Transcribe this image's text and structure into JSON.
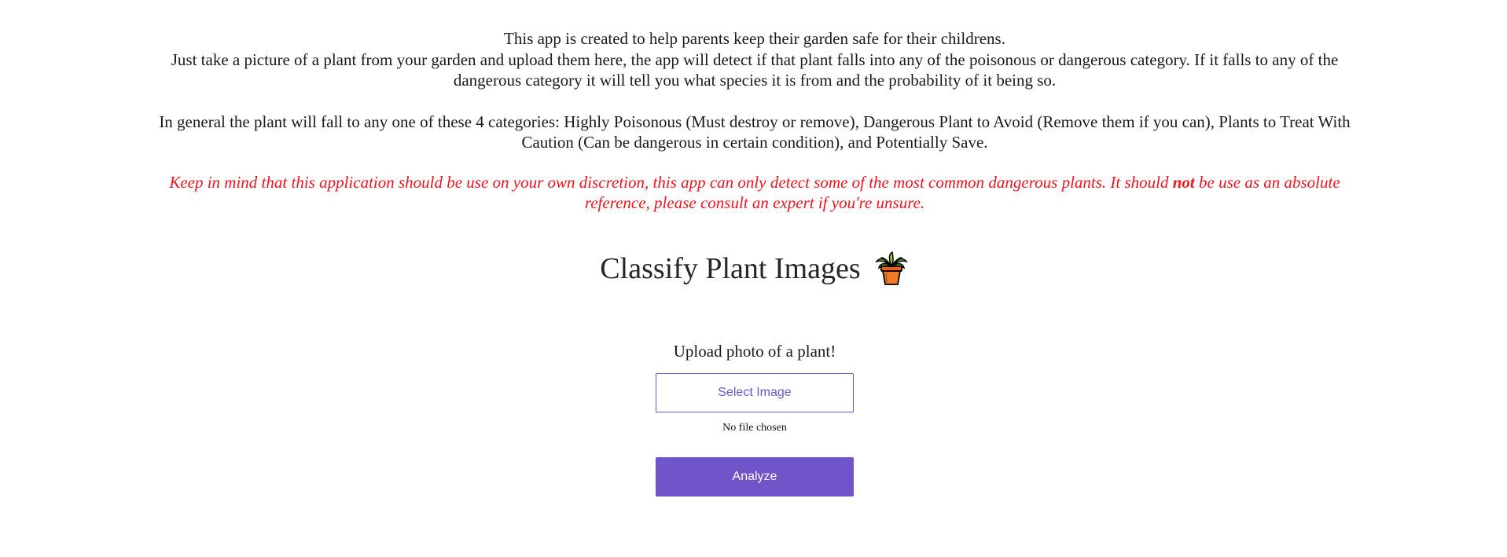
{
  "intro": {
    "line1": "This app is created to help parents keep their garden safe for their childrens.",
    "line2": "Just take a picture of a plant from your garden and upload them here, the app will detect if that plant falls into any of the poisonous or dangerous category. If it falls to any of the dangerous category it will tell you what species it is from and the probability of it being so."
  },
  "categories_text": "In general the plant will fall to any one of these 4 categories: Highly Poisonous (Must destroy or remove), Dangerous Plant to Avoid (Remove them if you can), Plants to Treat With Caution (Can be dangerous in certain condition), and Potentially Save.",
  "warning": {
    "before": "Keep in mind that this application should be use on your own discretion, this app can only detect some of the most common dangerous plants. It should ",
    "emphasis": "not",
    "after": " be use as an absolute reference, please consult an expert if you're unsure.",
    "color": "#f0141e"
  },
  "title": {
    "text": "Classify Plant Images",
    "icon": "potted-plant-icon"
  },
  "upload": {
    "label": "Upload photo of a plant!",
    "select_button": "Select Image",
    "file_status": "No file chosen",
    "analyze_button": "Analyze",
    "accent_color": "#6f55c9"
  }
}
